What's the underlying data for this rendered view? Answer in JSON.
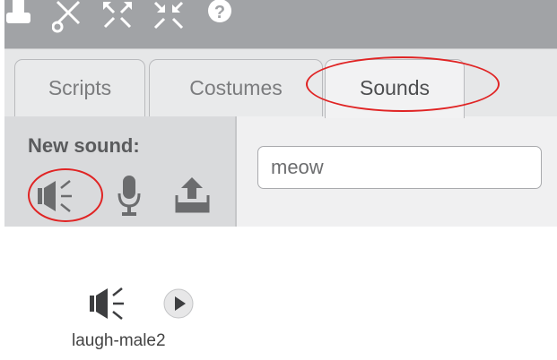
{
  "toolbar": {
    "tools": [
      {
        "icon": "stamp-icon"
      },
      {
        "icon": "cut-icon"
      },
      {
        "icon": "grow-icon"
      },
      {
        "icon": "shrink-icon"
      },
      {
        "icon": "help-icon"
      }
    ]
  },
  "tabs": [
    {
      "label": "Scripts",
      "active": false
    },
    {
      "label": "Costumes",
      "active": false
    },
    {
      "label": "Sounds",
      "active": true
    }
  ],
  "new_sound": {
    "title": "New sound:",
    "buttons": [
      {
        "icon": "sound-library-icon",
        "highlighted": true
      },
      {
        "icon": "microphone-icon",
        "highlighted": false
      },
      {
        "icon": "upload-icon",
        "highlighted": false
      }
    ]
  },
  "sound_name": {
    "value": "meow"
  },
  "sound_card": {
    "icons": [
      "sound-library-icon",
      "play-icon"
    ],
    "label": "laugh-male2"
  },
  "colors": {
    "highlight_ring": "#e02424",
    "toolbar": "#a1a3a6"
  }
}
